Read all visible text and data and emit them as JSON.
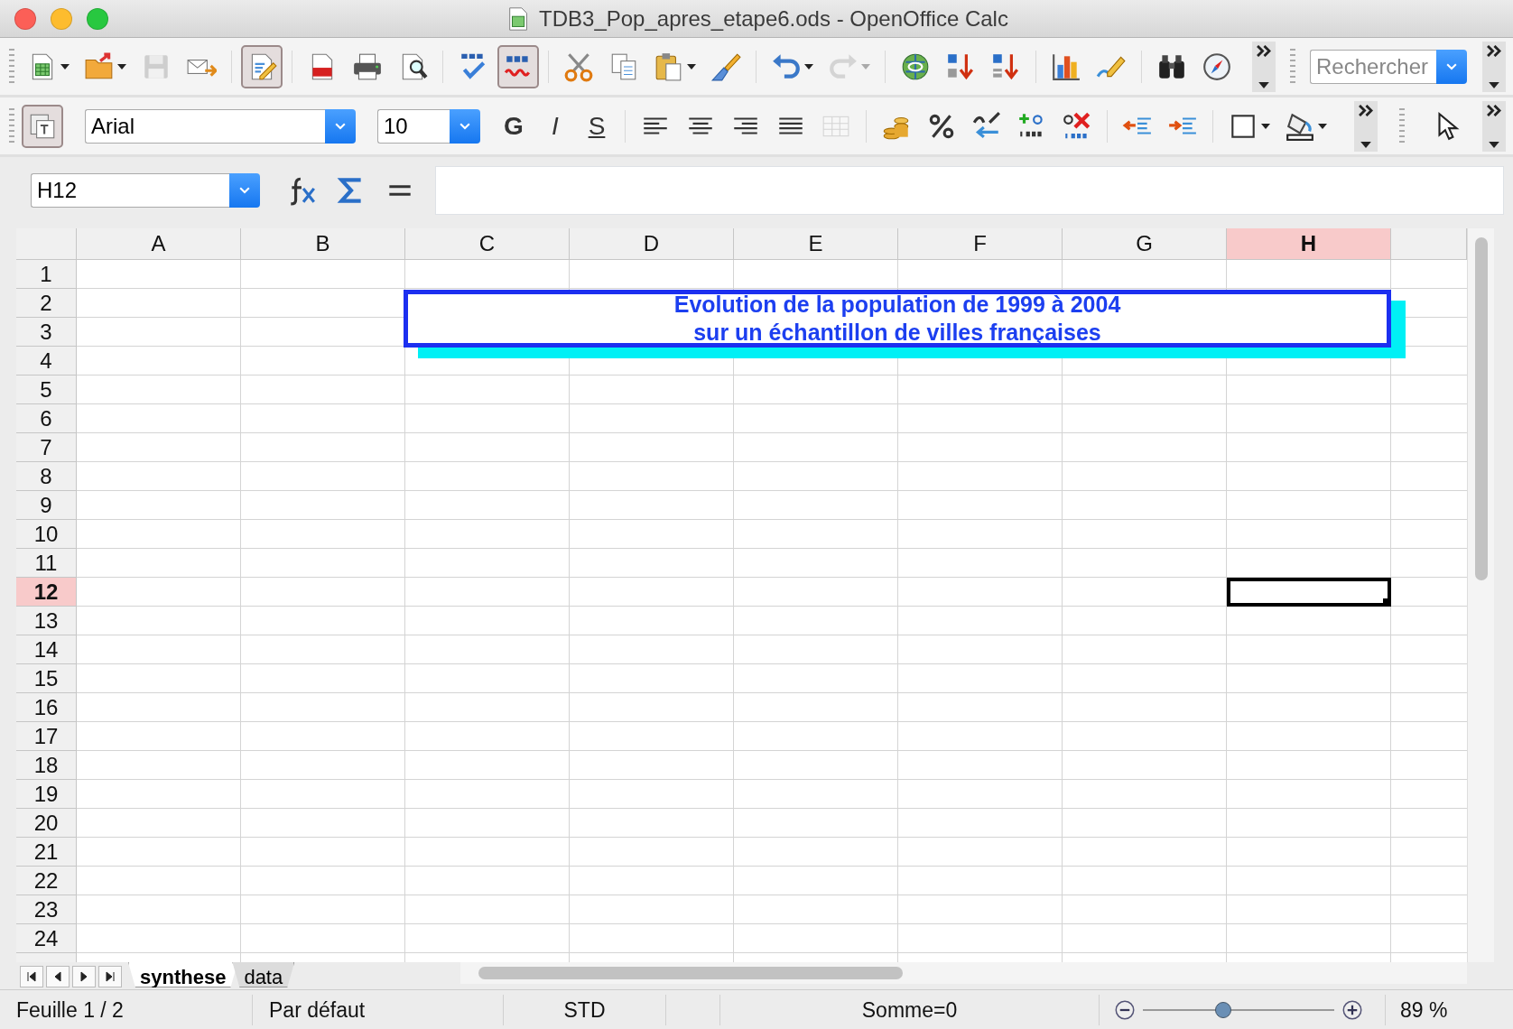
{
  "window": {
    "title": "TDB3_Pop_apres_etape6.ods - OpenOffice Calc"
  },
  "standard_toolbar": [
    [
      {
        "kind": "new",
        "dropdown": true,
        "disabled": false,
        "pressed": false
      },
      {
        "kind": "open",
        "dropdown": true,
        "disabled": false,
        "pressed": false
      },
      {
        "kind": "save",
        "dropdown": false,
        "disabled": true,
        "pressed": false
      },
      {
        "kind": "mail",
        "dropdown": false,
        "disabled": false,
        "pressed": false
      }
    ],
    [
      {
        "kind": "edit",
        "dropdown": false,
        "disabled": false,
        "pressed": true
      }
    ],
    [
      {
        "kind": "pdf",
        "dropdown": false,
        "disabled": false,
        "pressed": false
      },
      {
        "kind": "print",
        "dropdown": false,
        "disabled": false,
        "pressed": false
      },
      {
        "kind": "preview",
        "dropdown": false,
        "disabled": false,
        "pressed": false
      }
    ],
    [
      {
        "kind": "spell",
        "dropdown": false,
        "disabled": false,
        "pressed": false
      },
      {
        "kind": "autospell",
        "dropdown": false,
        "disabled": false,
        "pressed": true
      }
    ],
    [
      {
        "kind": "cut",
        "dropdown": false,
        "disabled": false,
        "pressed": false
      },
      {
        "kind": "copy",
        "dropdown": false,
        "disabled": false,
        "pressed": false
      },
      {
        "kind": "paste",
        "dropdown": true,
        "disabled": false,
        "pressed": false
      },
      {
        "kind": "brush",
        "dropdown": false,
        "disabled": false,
        "pressed": false
      }
    ],
    [
      {
        "kind": "undo",
        "dropdown": true,
        "disabled": false,
        "pressed": false
      },
      {
        "kind": "redo",
        "dropdown": true,
        "disabled": true,
        "pressed": false
      }
    ],
    [
      {
        "kind": "hyperlink",
        "dropdown": false,
        "disabled": false,
        "pressed": false
      },
      {
        "kind": "sortasc",
        "dropdown": false,
        "disabled": false,
        "pressed": false
      },
      {
        "kind": "sortdesc",
        "dropdown": false,
        "disabled": false,
        "pressed": false
      }
    ],
    [
      {
        "kind": "chart",
        "dropdown": false,
        "disabled": false,
        "pressed": false
      },
      {
        "kind": "draw",
        "dropdown": false,
        "disabled": false,
        "pressed": false
      }
    ],
    [
      {
        "kind": "find",
        "dropdown": false,
        "disabled": false,
        "pressed": false
      },
      {
        "kind": "navigator",
        "dropdown": false,
        "disabled": false,
        "pressed": false
      }
    ]
  ],
  "search": {
    "placeholder": "Rechercher"
  },
  "formatting_toolbar": {
    "styles_pressed": true,
    "font_name": "Arial",
    "font_size": "10",
    "button_groups": [
      [
        {
          "kind": "bold",
          "label": "G",
          "dropdown": false,
          "disabled": false
        },
        {
          "kind": "italic",
          "label": "I",
          "dropdown": false,
          "disabled": false
        },
        {
          "kind": "underline",
          "label": "S",
          "dropdown": false,
          "disabled": false
        }
      ],
      [
        {
          "kind": "alignleft",
          "dropdown": false,
          "disabled": false
        },
        {
          "kind": "aligncenter",
          "dropdown": false,
          "disabled": false
        },
        {
          "kind": "alignright",
          "dropdown": false,
          "disabled": false
        },
        {
          "kind": "justify",
          "dropdown": false,
          "disabled": false
        },
        {
          "kind": "merge",
          "dropdown": false,
          "disabled": true
        }
      ],
      [
        {
          "kind": "currency",
          "dropdown": false,
          "disabled": false
        },
        {
          "kind": "percent",
          "dropdown": false,
          "disabled": false
        },
        {
          "kind": "standard",
          "dropdown": false,
          "disabled": false
        },
        {
          "kind": "adddecimal",
          "dropdown": false,
          "disabled": false
        },
        {
          "kind": "deldecimal",
          "dropdown": false,
          "disabled": false
        }
      ],
      [
        {
          "kind": "outdent",
          "dropdown": false,
          "disabled": false
        },
        {
          "kind": "indent",
          "dropdown": false,
          "disabled": false
        }
      ],
      [
        {
          "kind": "borders",
          "dropdown": true,
          "disabled": false
        },
        {
          "kind": "fill",
          "dropdown": true,
          "disabled": false
        }
      ]
    ]
  },
  "formula_bar": {
    "cell_reference": "H12"
  },
  "sheet": {
    "columns": [
      {
        "label": "A",
        "selected": false
      },
      {
        "label": "B",
        "selected": false
      },
      {
        "label": "C",
        "selected": false
      },
      {
        "label": "D",
        "selected": false
      },
      {
        "label": "E",
        "selected": false
      },
      {
        "label": "F",
        "selected": false
      },
      {
        "label": "G",
        "selected": false
      },
      {
        "label": "H",
        "selected": true
      }
    ],
    "rows": [
      {
        "label": "1",
        "selected": false
      },
      {
        "label": "2",
        "selected": false
      },
      {
        "label": "3",
        "selected": false
      },
      {
        "label": "4",
        "selected": false
      },
      {
        "label": "5",
        "selected": false
      },
      {
        "label": "6",
        "selected": false
      },
      {
        "label": "7",
        "selected": false
      },
      {
        "label": "8",
        "selected": false
      },
      {
        "label": "9",
        "selected": false
      },
      {
        "label": "10",
        "selected": false
      },
      {
        "label": "11",
        "selected": false
      },
      {
        "label": "12",
        "selected": true
      },
      {
        "label": "13",
        "selected": false
      },
      {
        "label": "14",
        "selected": false
      },
      {
        "label": "15",
        "selected": false
      },
      {
        "label": "16",
        "selected": false
      },
      {
        "label": "17",
        "selected": false
      },
      {
        "label": "18",
        "selected": false
      },
      {
        "label": "19",
        "selected": false
      },
      {
        "label": "20",
        "selected": false
      },
      {
        "label": "21",
        "selected": false
      },
      {
        "label": "22",
        "selected": false
      },
      {
        "label": "23",
        "selected": false
      },
      {
        "label": "24",
        "selected": false
      }
    ],
    "text_box": {
      "lines": [
        "Evolution de la population de 1999 à 2004",
        "sur un échantillon de villes françaises"
      ]
    }
  },
  "sheet_tabs": [
    {
      "label": "synthese",
      "selected": true
    },
    {
      "label": "data",
      "selected": false
    }
  ],
  "status_bar": {
    "sheet": "Feuille 1 / 2",
    "page_style": "Par défaut",
    "selection_mode": "STD",
    "sum": "Somme=0",
    "zoom": {
      "level": 0.42
    },
    "zoom_percent": "89 %"
  }
}
